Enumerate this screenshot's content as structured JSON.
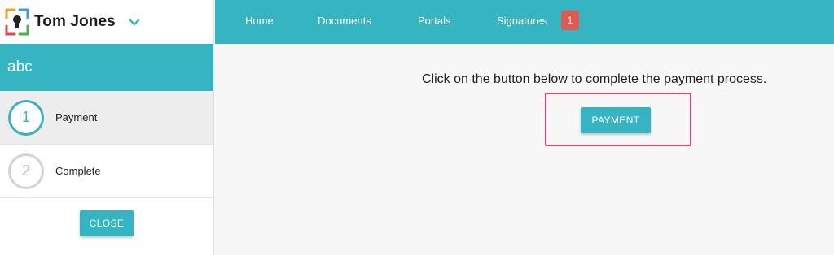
{
  "user": {
    "name": "Tom Jones"
  },
  "sidebar": {
    "project_name": "abc",
    "steps": [
      {
        "number": "1",
        "label": "Payment"
      },
      {
        "number": "2",
        "label": "Complete"
      }
    ],
    "close_label": "CLOSE"
  },
  "nav": {
    "home": "Home",
    "documents": "Documents",
    "portals": "Portals",
    "signatures": "Signatures",
    "signatures_badge": "1"
  },
  "main": {
    "instruction": "Click on the button below to complete the payment process.",
    "payment_label": "PAYMENT"
  },
  "colors": {
    "accent": "#34b5c1",
    "badge": "#e05a50",
    "highlight": "#e0457b"
  }
}
